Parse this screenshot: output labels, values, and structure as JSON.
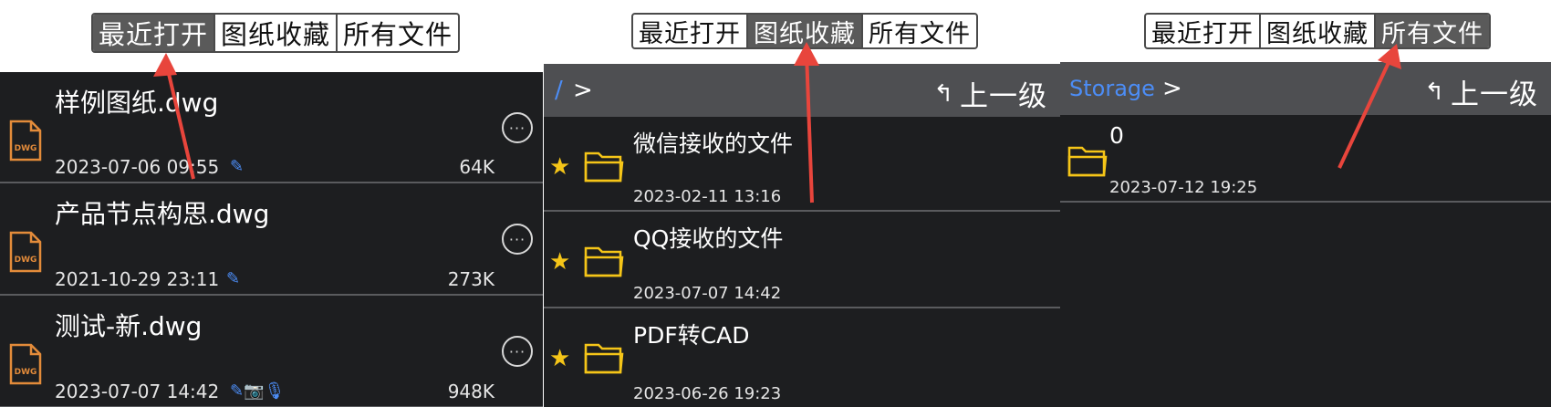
{
  "tabs": [
    "最近打开",
    "图纸收藏",
    "所有文件"
  ],
  "recent": {
    "active_tab": 0,
    "files": [
      {
        "name": "样例图纸.dwg",
        "date": "2023-07-06 09:55",
        "attachments": "✎",
        "size": "64K",
        "icon_label": "DWG"
      },
      {
        "name": "产品节点构思.dwg",
        "date": "2021-10-29 23:11",
        "attachments": "✎",
        "size": "273K",
        "icon_label": "DWG"
      },
      {
        "name": "测试-新.dwg",
        "date": "2023-07-07 14:42",
        "attachments": "✎📷🎙",
        "size": "948K",
        "icon_label": "DWG"
      }
    ],
    "more_glyph": "···"
  },
  "favorites": {
    "active_tab": 1,
    "path": "/",
    "path_chevron": ">",
    "up_label": "上一级",
    "up_glyph": "↰",
    "folders": [
      {
        "name": "微信接收的文件",
        "date": "2023-02-11 13:16",
        "starred": true
      },
      {
        "name": "QQ接收的文件",
        "date": "2023-07-07 14:42",
        "starred": true
      },
      {
        "name": "PDF转CAD",
        "date": "2023-06-26 19:23",
        "starred": true
      }
    ]
  },
  "all_files": {
    "active_tab": 2,
    "path": "Storage",
    "path_chevron": ">",
    "up_label": "上一级",
    "up_glyph": "↰",
    "folders": [
      {
        "name": "0",
        "date": "2023-07-12 19:25"
      }
    ]
  },
  "colors": {
    "dark_bg": "#1d1e20",
    "path_bar": "#4e4f52",
    "accent_blue": "#4c8df6",
    "dwg_orange": "#e38b3a",
    "folder_yellow": "#f5c518",
    "arrow_red": "#e8453c"
  },
  "icons": {
    "file": "dwg-file-icon",
    "folder": "folder-icon",
    "star": "star-icon",
    "more": "more-icon",
    "up": "up-level-icon",
    "annotation": "red-arrow-annotation"
  }
}
